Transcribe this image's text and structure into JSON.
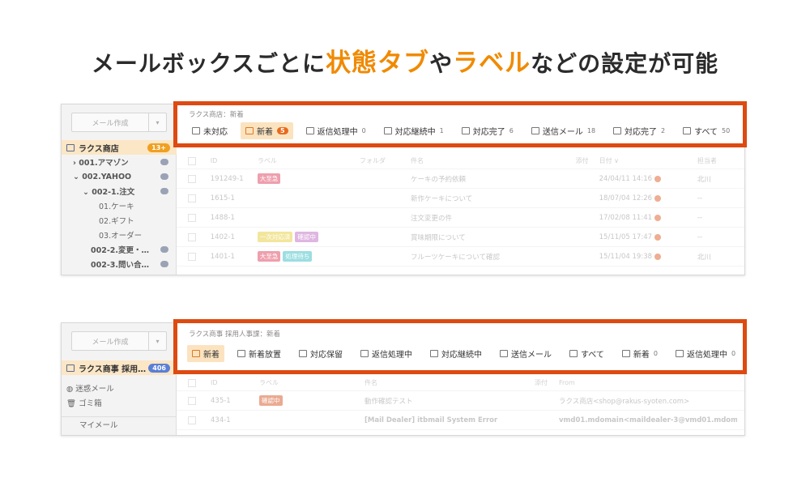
{
  "headline": {
    "part1": "メールボックスごとに",
    "accent1": "状態タブ",
    "part2": "や",
    "accent2": "ラベル",
    "part3": "などの設定が可能"
  },
  "panel1": {
    "compose_label": "メール作成",
    "breadcrumb": "ラクス商店：新着",
    "tabs": [
      {
        "label": "未対応",
        "count": ""
      },
      {
        "label": "新着",
        "count": "5"
      },
      {
        "label": "返信処理中",
        "count": "0"
      },
      {
        "label": "対応継続中",
        "count": "1"
      },
      {
        "label": "対応完了",
        "count": "6"
      },
      {
        "label": "送信メール",
        "count": "18"
      },
      {
        "label": "対応完了",
        "count": "2"
      },
      {
        "label": "すべて",
        "count": "50"
      }
    ],
    "account": {
      "label": "ラクス商店",
      "badge": "13+"
    },
    "tree": [
      {
        "label": "› 001.アマゾン",
        "count": ""
      },
      {
        "label": "⌄ 002.YAHOO",
        "count": ""
      },
      {
        "label": "⌄ 002-1.注文",
        "count": ""
      },
      {
        "label": "01.ケーキ",
        "count": ""
      },
      {
        "label": "02.ギフト",
        "count": ""
      },
      {
        "label": "03.オーダー",
        "count": ""
      },
      {
        "label": "002-2.変更・…",
        "count": ""
      },
      {
        "label": "002-3.問い合…",
        "count": ""
      }
    ],
    "columns": {
      "id": "ID",
      "label": "ラベル",
      "folder": "フォルダ",
      "subject": "件名",
      "attach": "添付",
      "date": "日付 ∨",
      "owner": "担当者"
    },
    "rows": [
      {
        "id": "191249-1",
        "labels": [
          {
            "text": "大至急",
            "color": "#e0506a"
          }
        ],
        "subject": "ケーキの予約依頼",
        "date": "24/04/11 14:16",
        "owner": "北川"
      },
      {
        "id": "1615-1",
        "labels": [],
        "subject": "新作ケーキについて",
        "date": "18/07/04 12:26",
        "owner": "--"
      },
      {
        "id": "1488-1",
        "labels": [],
        "subject": "注文変更の件",
        "date": "17/02/08 11:41",
        "owner": "--"
      },
      {
        "id": "1402-1",
        "labels": [
          {
            "text": "一次対応済",
            "color": "#e8d24c"
          },
          {
            "text": "確認中",
            "color": "#c57ac9"
          }
        ],
        "subject": "賞味期限について",
        "date": "15/11/05 17:47",
        "owner": "--"
      },
      {
        "id": "1401-1",
        "labels": [
          {
            "text": "大至急",
            "color": "#e0506a"
          },
          {
            "text": "処理待ち",
            "color": "#4cc3c9"
          }
        ],
        "subject": "フルーツケーキについて確認",
        "date": "15/11/04 19:38",
        "owner": "北川"
      }
    ]
  },
  "panel2": {
    "compose_label": "メール作成",
    "breadcrumb": "ラクス商事 採用人事課：新着",
    "tabs": [
      {
        "label": "新着",
        "count": ""
      },
      {
        "label": "新着放置",
        "count": ""
      },
      {
        "label": "対応保留",
        "count": ""
      },
      {
        "label": "返信処理中",
        "count": ""
      },
      {
        "label": "対応継続中",
        "count": ""
      },
      {
        "label": "送信メール",
        "count": ""
      },
      {
        "label": "すべて",
        "count": ""
      },
      {
        "label": "新着",
        "count": "0"
      },
      {
        "label": "返信処理中",
        "count": "0"
      }
    ],
    "account": {
      "label": "ラクス商事 採用…",
      "badge": "406"
    },
    "tree": [
      {
        "label": "◍ 迷惑メール",
        "count": ""
      },
      {
        "label": "🗑 ゴミ箱",
        "count": ""
      },
      {
        "label": "マイメール",
        "count": ""
      }
    ],
    "columns": {
      "id": "ID",
      "label": "ラベル",
      "subject": "件名",
      "attach": "添付",
      "from": "From"
    },
    "rows": [
      {
        "id": "435-1",
        "labels": [
          {
            "text": "確認中",
            "color": "#d9643a"
          }
        ],
        "subject": "動作確認テスト",
        "from": "ラクス商店<shop@rakus-syoten.com>"
      },
      {
        "id": "434-1",
        "labels": [],
        "subject": "[Mail Dealer] itbmail System Error",
        "from": "vmd01.mdomain<maildealer-3@vmd01.mdom"
      }
    ]
  },
  "colors": {
    "accent": "#f08a00",
    "highlight_border": "#dd4a12",
    "tab_active_bg": "#fbe3c0"
  }
}
